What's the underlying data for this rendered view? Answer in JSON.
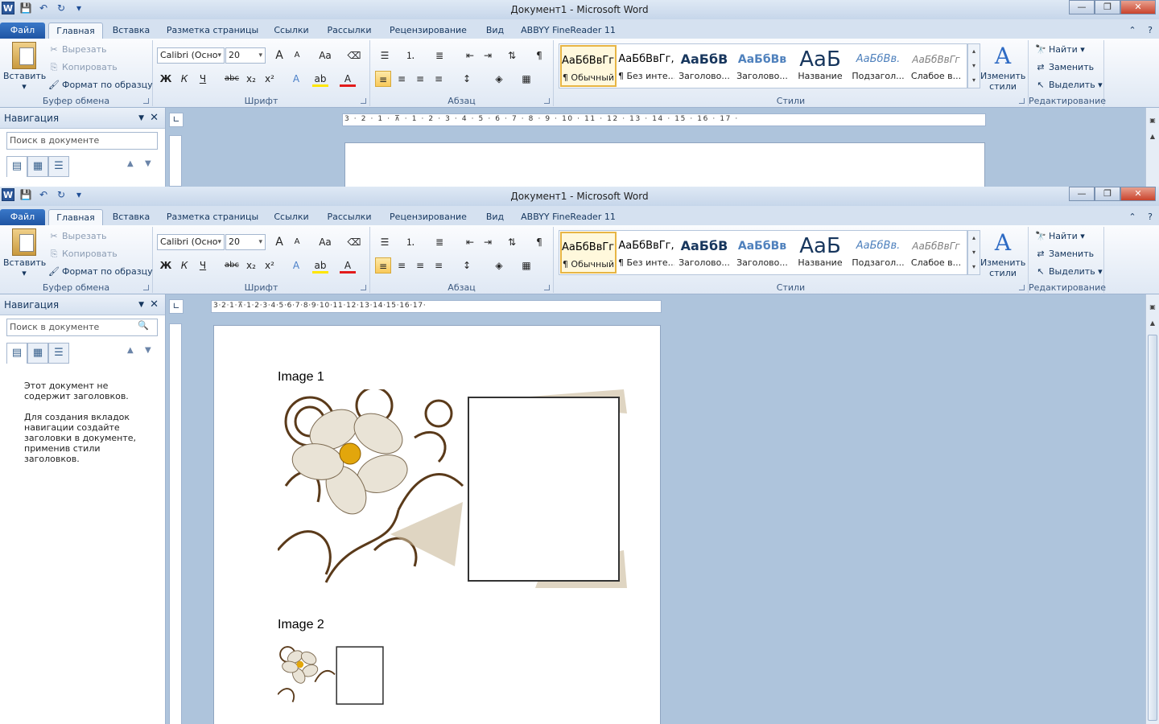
{
  "app": {
    "title": "Документ1  -  Microsoft Word",
    "logo_letter": "W"
  },
  "window_controls": {
    "minimize": "—",
    "restore": "❐",
    "close": "✕"
  },
  "tabs": [
    "Файл",
    "Главная",
    "Вставка",
    "Разметка страницы",
    "Ссылки",
    "Рассылки",
    "Рецензирование",
    "Вид",
    "ABBYY FineReader 11"
  ],
  "ribbon": {
    "clipboard": {
      "label": "Буфер обмена",
      "paste": "Вставить",
      "cut": "Вырезать",
      "copy": "Копировать",
      "format_painter": "Формат по образцу"
    },
    "font": {
      "label": "Шрифт",
      "family": "Calibri (Осно",
      "size": "20",
      "bold": "Ж",
      "italic": "К",
      "underline": "Ч",
      "strike": "abc",
      "sub": "x₂",
      "sup": "x²",
      "grow": "A",
      "shrink": "A",
      "case": "Aa"
    },
    "paragraph": {
      "label": "Абзац",
      "show_marks": "¶"
    },
    "styles": {
      "label": "Стили",
      "items": [
        {
          "sample": "АаБбВвГг,",
          "name": "¶ Обычный"
        },
        {
          "sample": "АаБбВвГг,",
          "name": "¶ Без инте..."
        },
        {
          "sample": "АаБбВ",
          "name": "Заголово..."
        },
        {
          "sample": "АаБбВв",
          "name": "Заголово..."
        },
        {
          "sample": "АаБ",
          "name": "Название"
        },
        {
          "sample": "АаБбВв.",
          "name": "Подзагол..."
        },
        {
          "sample": "АаБбВвГг",
          "name": "Слабое в..."
        }
      ],
      "change": "Изменить стили"
    },
    "editing": {
      "label": "Редактирование",
      "find": "Найти",
      "replace": "Заменить",
      "select": "Выделить"
    }
  },
  "navigation": {
    "title": "Навигация",
    "search_placeholder": "Поиск в документе",
    "message_1": "Этот документ не содержит заголовков.",
    "message_2": "Для создания вкладок навигации создайте заголовки в документе, применив стили заголовков."
  },
  "ruler": {
    "win1": "3 · 2 · 1 · ⊼ · 1 · 2 · 3 · 4 · 5 · 6 · 7 · 8 · 9 · 10 · 11 · 12 · 13 · 14 · 15 · 16 · 17 ·",
    "win2": "3·2·1·⊼·1·2·3·4·5·6·7·8·9·10·11·12·13·14·15·16·17·"
  },
  "document": {
    "heading_1": "Image 1",
    "heading_2": "Image 2"
  },
  "colors": {
    "accent": "#2b579a",
    "ribbon_bg": "#dfe8f4",
    "selected": "#f9c95a",
    "workspace": "#aec4dc"
  }
}
